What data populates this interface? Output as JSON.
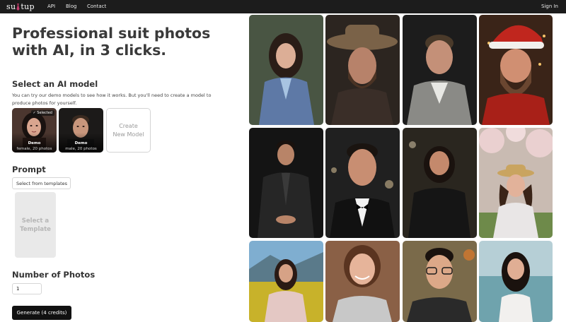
{
  "nav": {
    "logo_left": "su",
    "logo_right": "tup",
    "links": [
      "API",
      "Blog",
      "Contact"
    ],
    "signin": "Sign In"
  },
  "hero": {
    "title_line1": "Professional suit photos",
    "title_line2": "with AI, in 3 clicks."
  },
  "model_section": {
    "heading": "Select an AI model",
    "description": "You can try our demo models to see how it works. But you'll need to create a model to produce photos for yourself.",
    "cards": [
      {
        "name": "Demo",
        "sub": "female, 20 photos",
        "badge": "✓ Selected"
      },
      {
        "name": "Demo",
        "sub": "male, 20 photos"
      }
    ],
    "create_line1": "Create",
    "create_line2": "New Model"
  },
  "prompt_section": {
    "heading": "Prompt",
    "select_label": "Select from templates",
    "template_line1": "Select a",
    "template_line2": "Template"
  },
  "photos_section": {
    "heading": "Number of Photos",
    "value": "1"
  },
  "generate_label": "Generate (4 credits)",
  "gallery": [
    {
      "icon": "woman-blue-suit-photo"
    },
    {
      "icon": "bearded-man-hat-photo"
    },
    {
      "icon": "man-grey-suit-photo"
    },
    {
      "icon": "santa-hat-man-photo"
    },
    {
      "icon": "man-black-suit-photo"
    },
    {
      "icon": "man-tuxedo-photo"
    },
    {
      "icon": "woman-black-jacket-photo"
    },
    {
      "icon": "woman-hat-blossoms-photo"
    },
    {
      "icon": "woman-flower-field-photo"
    },
    {
      "icon": "smiling-woman-photo"
    },
    {
      "icon": "man-glasses-photo"
    },
    {
      "icon": "woman-beach-photo"
    }
  ],
  "colors": {
    "nav_bg": "#1c1c1c",
    "button_bg": "#111111",
    "accent_tie": "#c23b6b"
  }
}
